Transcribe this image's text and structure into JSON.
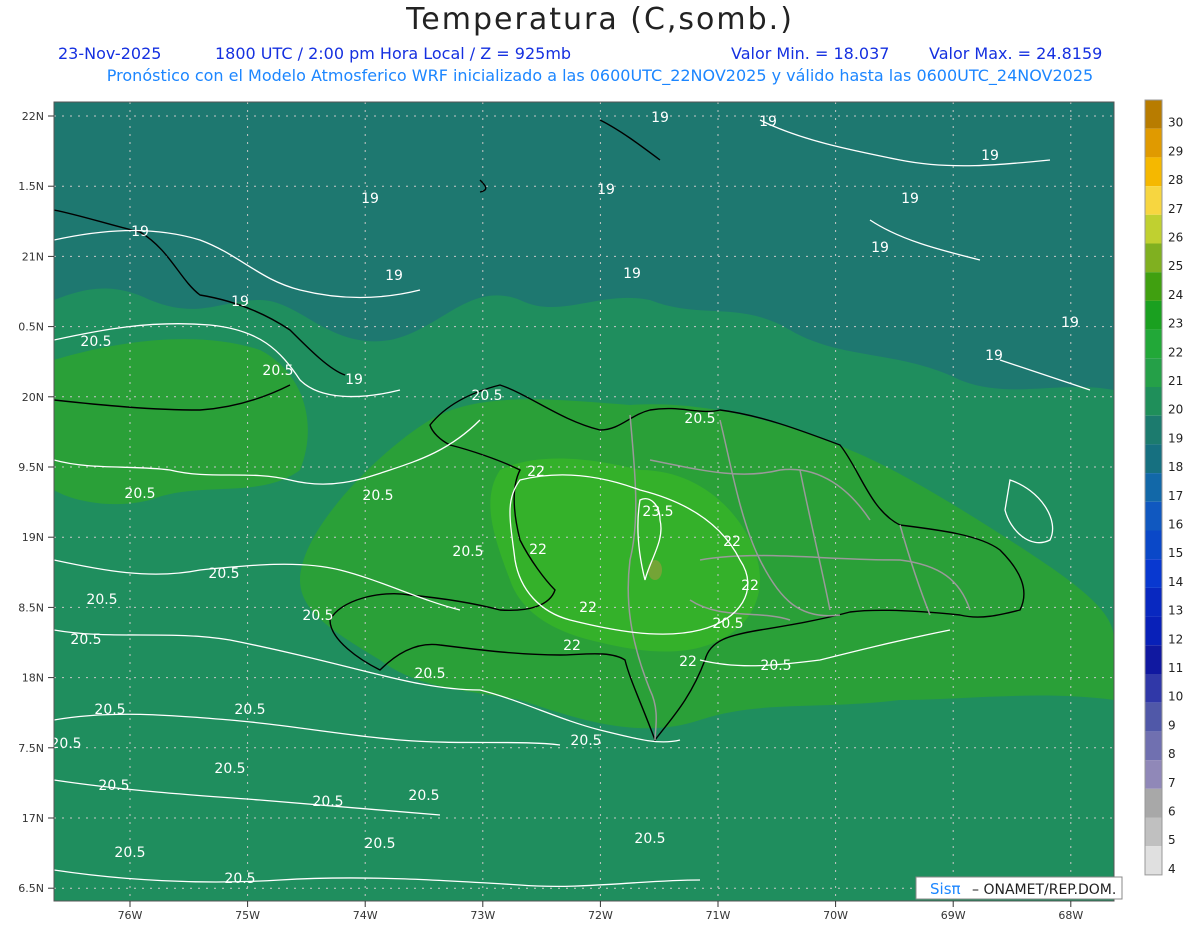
{
  "header": {
    "title": "Temperatura (C,somb.)",
    "date": "23-Nov-2025",
    "time": "1800 UTC / 2:00 pm Hora Local / Z = 925mb",
    "min": "Valor Min. = 18.037",
    "max": "Valor Max. = 24.8159",
    "subtitle": "Pronóstico con el Modelo Atmosferico WRF inicializado a las 0600UTC_22NOV2025 y válido hasta las  0600UTC_24NOV2025"
  },
  "axes": {
    "lat_labels": [
      "22N",
      "1.5N",
      "21N",
      "0.5N",
      "20N",
      "9.5N",
      "19N",
      "8.5N",
      "18N",
      "7.5N",
      "17N",
      "6.5N"
    ],
    "lon_labels": [
      "76W",
      "75W",
      "74W",
      "73W",
      "72W",
      "71W",
      "70W",
      "69W",
      "68W"
    ]
  },
  "colorbar": {
    "labels": [
      "30",
      "29",
      "28",
      "27",
      "26",
      "25",
      "24",
      "23",
      "22",
      "21",
      "20",
      "19",
      "18",
      "17",
      "16",
      "15",
      "14",
      "13",
      "12",
      "11",
      "10",
      "9",
      "8",
      "7",
      "6",
      "5",
      "4"
    ],
    "colors": [
      "#b87c00",
      "#e09a00",
      "#f5b800",
      "#f7d640",
      "#c0d030",
      "#80b020",
      "#40a010",
      "#1aa020",
      "#22a838",
      "#25a048",
      "#1f8f5a",
      "#1c7b6e",
      "#167080",
      "#1268a8",
      "#1058c0",
      "#0a48c8",
      "#0838d0",
      "#0828c0",
      "#0820b8",
      "#1018a0",
      "#3038a8",
      "#5058a8",
      "#7070b0",
      "#9088b8",
      "#a8a8a8",
      "#c0c0c0",
      "#e0e0e0"
    ]
  },
  "contours": {
    "labels": [
      "19",
      "19",
      "19",
      "19",
      "19",
      "19",
      "19",
      "19",
      "19",
      "19",
      "19",
      "19",
      "19",
      "19",
      "20.5",
      "20.5",
      "20.5",
      "20.5",
      "20.5",
      "20.5",
      "20.5",
      "20.5",
      "20.5",
      "20.5",
      "20.5",
      "20.5",
      "20.5",
      "20.5",
      "20.5",
      "20.5",
      "20.5",
      "20.5",
      "20.5",
      "20.5",
      "20.5",
      "20.5",
      "20.5",
      "20.5",
      "20.5",
      "20.5",
      "22",
      "22",
      "22",
      "22",
      "22",
      "22",
      "22",
      "23.5"
    ]
  },
  "credit": {
    "brand": "Sisπ",
    "org": "– ONAMET/REP.DOM."
  },
  "colors": {
    "sea": "#1f8e5e",
    "deep": "#1e7870",
    "land_warm": "#2aa038",
    "land_hot": "#34b12a",
    "peak": "#74a436"
  }
}
